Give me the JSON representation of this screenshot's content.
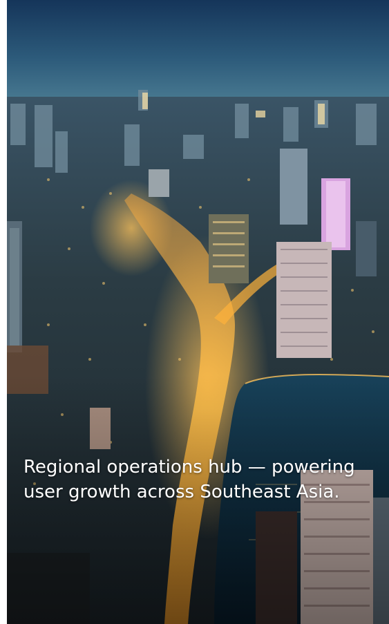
{
  "hero": {
    "image_subject": "night-city-aerial-photo",
    "caption": "Regional operations hub — powering user growth across Southeast Asia."
  },
  "colors": {
    "sky_top": "#17375c",
    "sky_horizon": "#3c6b86",
    "city_shadow": "#14212c",
    "street_glow": "#ffb23a",
    "lake_water": "#0c2a3e",
    "caption_text": "#ffffff"
  }
}
